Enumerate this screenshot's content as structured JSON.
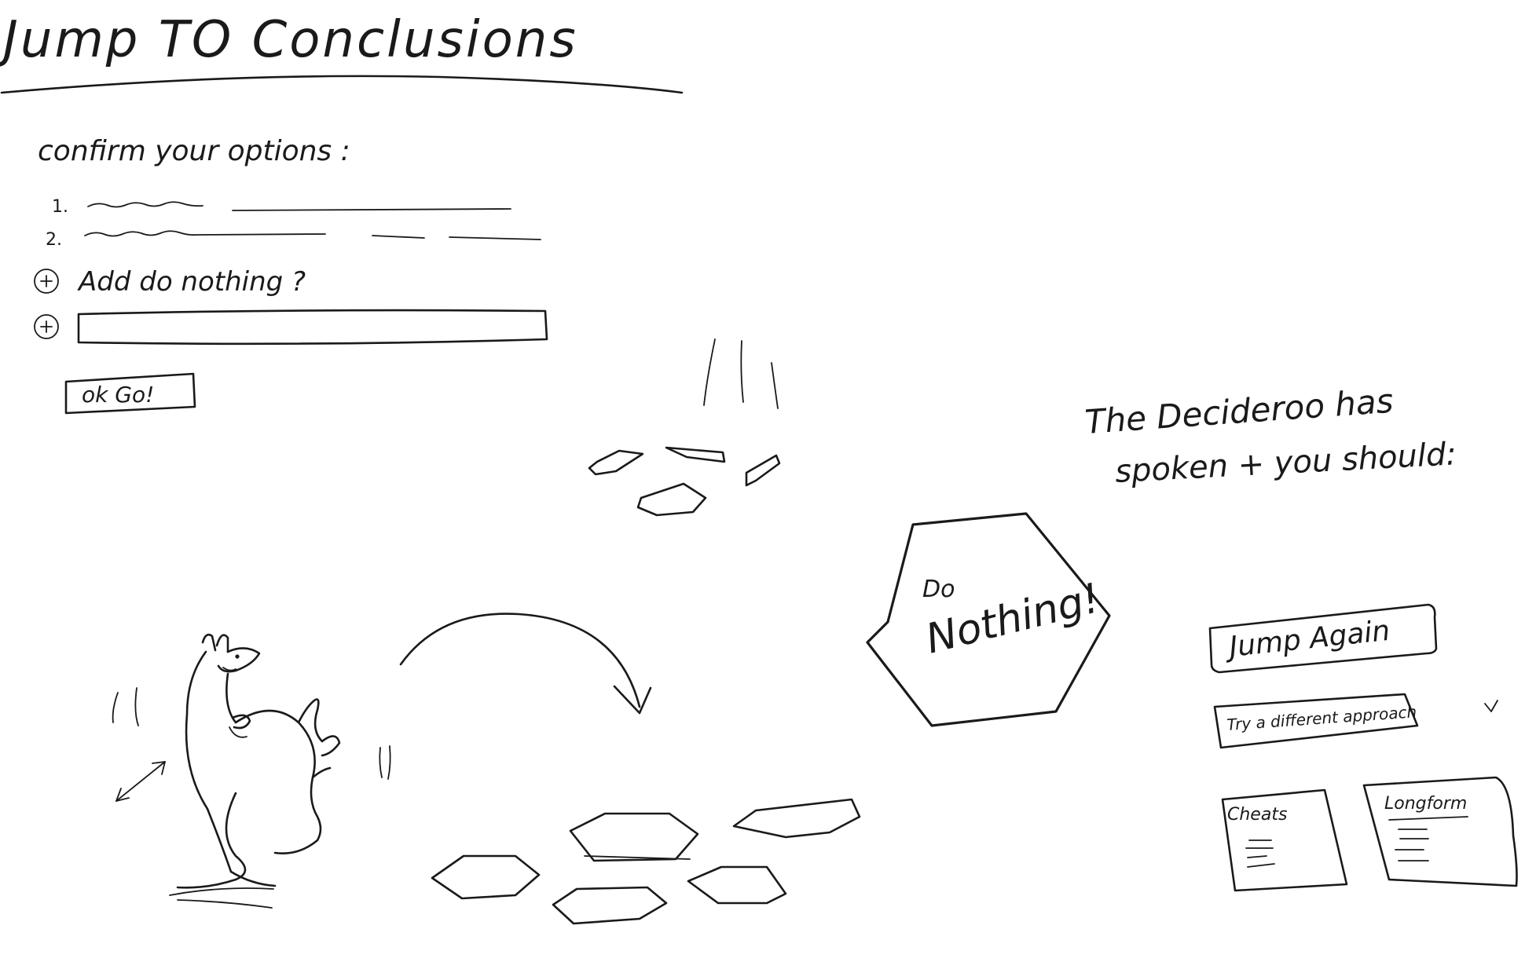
{
  "title": "Jump TO Conclusions",
  "form": {
    "heading": "confirm your options :",
    "option_numbers": [
      "1.",
      "2."
    ],
    "add_do_nothing_label": "Add do nothing ?",
    "go_button_label": "ok Go!"
  },
  "result": {
    "intro_line_1": "The Decideroo has",
    "intro_line_2": "spoken + you should:",
    "hexagon_line_1": "Do",
    "hexagon_line_2": "Nothing!",
    "jump_again_label": "Jump Again",
    "try_different_label": "Try a different approach",
    "card_left_title": "Cheats",
    "card_right_title": "Longform"
  },
  "icons": [
    "add-circle-icon",
    "kangaroo-illustration",
    "jump-arc-arrow",
    "chevron-down-icon"
  ],
  "colors": {
    "ink": "#1a1a1a",
    "paper": "#ffffff"
  }
}
